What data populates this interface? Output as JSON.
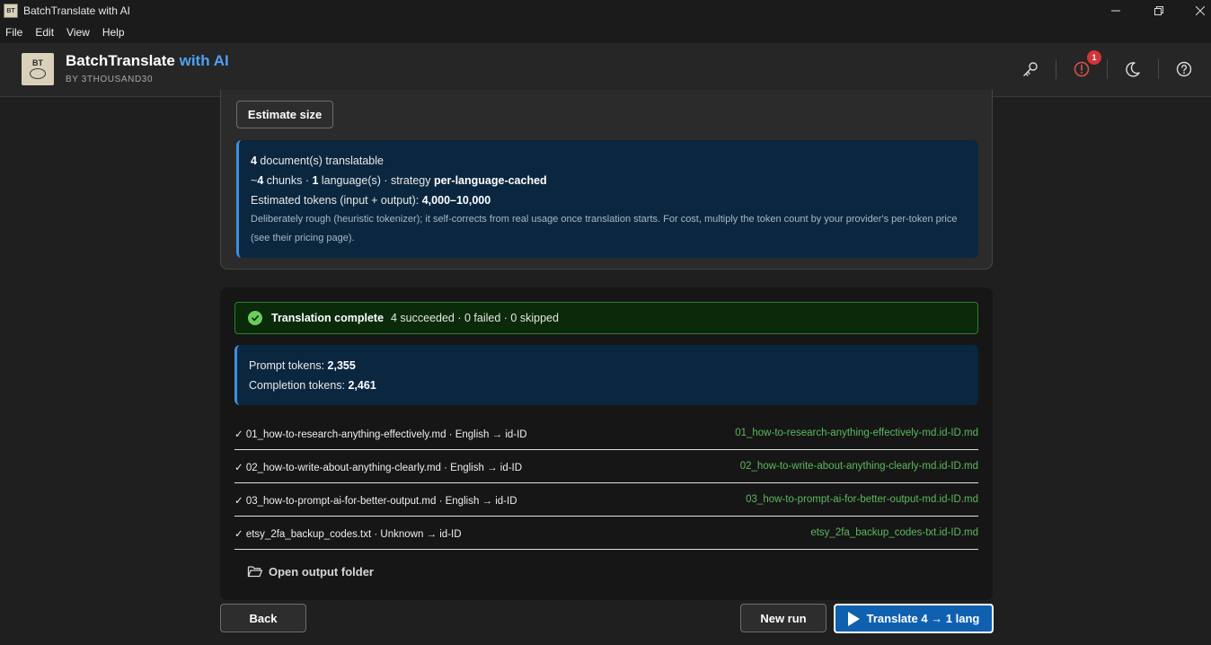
{
  "window": {
    "title": "BatchTranslate with AI"
  },
  "menu": {
    "items": [
      "File",
      "Edit",
      "View",
      "Help"
    ]
  },
  "header": {
    "logo_text": "BT",
    "brand": "BatchTranslate",
    "brand_accent": " with AI",
    "byline": "BY 3THOUSAND30",
    "notification_count": "1",
    "icons": [
      "key-icon",
      "alert-icon",
      "moon-icon",
      "help-icon"
    ]
  },
  "estimate": {
    "button_label": "Estimate size",
    "docs_count": "4",
    "docs_label": " document(s) translatable",
    "chunks_prefix": "~",
    "chunks_count": "4",
    "chunks_label": " chunks · ",
    "lang_count": "1",
    "lang_label": " language(s) · strategy ",
    "strategy": "per-language-cached",
    "tokens_label": "Estimated tokens (input + output): ",
    "tokens_range": "4,000–10,000",
    "note": "Deliberately rough (heuristic tokenizer); it self-corrects from real usage once translation starts. For cost, multiply the token count by your provider's per-token price (see their pricing page)."
  },
  "result": {
    "title": "Translation complete",
    "detail": " 4 succeeded · 0 failed · 0 skipped",
    "prompt_tokens_label": "Prompt tokens: ",
    "prompt_tokens": "2,355",
    "completion_tokens_label": "Completion tokens: ",
    "completion_tokens": "2,461",
    "files": [
      {
        "source": "✓ 01_how-to-research-anything-effectively.md · English → id-ID",
        "output": "01_how-to-research-anything-effectively-md.id-ID.md"
      },
      {
        "source": "✓ 02_how-to-write-about-anything-clearly.md · English → id-ID",
        "output": "02_how-to-write-about-anything-clearly-md.id-ID.md"
      },
      {
        "source": "✓ 03_how-to-prompt-ai-for-better-output.md · English → id-ID",
        "output": "03_how-to-prompt-ai-for-better-output-md.id-ID.md"
      },
      {
        "source": "✓ etsy_2fa_backup_codes.txt · Unknown → id-ID",
        "output": "etsy_2fa_backup_codes-txt.id-ID.md"
      }
    ],
    "open_folder_label": "Open output folder"
  },
  "footer": {
    "back_label": "Back",
    "new_run_label": "New run",
    "translate_label": "Translate 4 → 1 lang"
  },
  "colors": {
    "accent": "#4ea1f3",
    "success": "#5cb85c",
    "primary": "#1060b0",
    "danger": "#d13438"
  }
}
